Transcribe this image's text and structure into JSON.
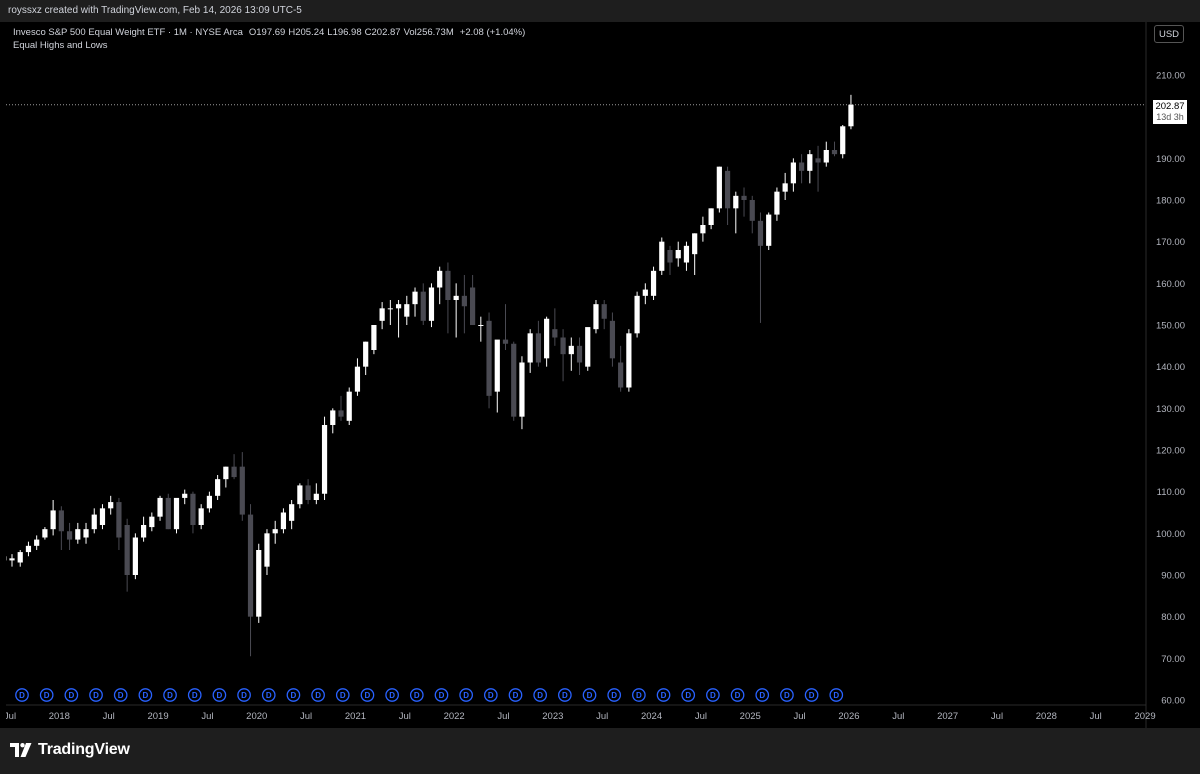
{
  "header": {
    "attribution": "royssxz created with TradingView.com, Feb 14, 2026 13:09 UTC-5"
  },
  "legend": {
    "symbol_line": "Invesco S&P 500 Equal Weight ETF · 1M · NYSE Arca",
    "open_label": "O",
    "open_value": "197.69",
    "high_label": "H",
    "high_value": "205.24",
    "low_label": "L",
    "low_value": "196.98",
    "close_label": "C",
    "close_value": "202.87",
    "volume_label": "Vol",
    "volume_value": "256.73M",
    "change": "+2.08 (+1.04%)",
    "indicator_name": "Equal Highs and Lows"
  },
  "currency_button": "USD",
  "price_tag": {
    "price": "202.87",
    "countdown": "13d 3h"
  },
  "footer": {
    "brand": "TradingView"
  },
  "colors": {
    "background": "#000000",
    "up_candle": "#ffffff",
    "down_candle": "#4a4a52",
    "axis_text": "#b2b5be",
    "dividend_marker": "#2962ff",
    "bar_background": "#1e1e1e"
  },
  "chart_data": {
    "type": "candlestick",
    "timeframe": "1M",
    "y_axis": {
      "min": 60,
      "max": 210,
      "ticks": [
        60,
        70,
        80,
        90,
        100,
        110,
        120,
        130,
        140,
        150,
        160,
        170,
        180,
        190,
        200,
        210
      ],
      "tick_labels": [
        "60.00",
        "70.00",
        "80.00",
        "90.00",
        "100.00",
        "110.00",
        "120.00",
        "130.00",
        "140.00",
        "150.00",
        "160.00",
        "170.00",
        "180.00",
        "190.00",
        "200.00",
        "210.00"
      ],
      "position": "right"
    },
    "x_axis": {
      "tick_labels": [
        "Jul",
        "2018",
        "Jul",
        "2019",
        "Jul",
        "2020",
        "Jul",
        "2021",
        "Jul",
        "2022",
        "Jul",
        "2023",
        "Jul",
        "2024",
        "Jul",
        "2025",
        "Jul",
        "2026",
        "Jul",
        "2027",
        "Jul",
        "2028",
        "Jul",
        "2029"
      ],
      "first_tick_month_index": 0,
      "months_per_tick": 6
    },
    "first_candle_month_index": -1,
    "last_price_line": 202.87,
    "candles": [
      {
        "o": 93.5,
        "h": 96,
        "l": 92,
        "c": 94.5
      },
      {
        "o": 93.5,
        "h": 95,
        "l": 92,
        "c": 94
      },
      {
        "o": 93,
        "h": 96,
        "l": 92,
        "c": 95.5
      },
      {
        "o": 95.5,
        "h": 98,
        "l": 94.5,
        "c": 97
      },
      {
        "o": 97,
        "h": 99.5,
        "l": 96,
        "c": 98.5
      },
      {
        "o": 99,
        "h": 101.5,
        "l": 98.5,
        "c": 101
      },
      {
        "o": 101,
        "h": 108,
        "l": 99.5,
        "c": 105.5
      },
      {
        "o": 105.5,
        "h": 106.5,
        "l": 96,
        "c": 100.5
      },
      {
        "o": 100.5,
        "h": 102.5,
        "l": 96,
        "c": 98.5
      },
      {
        "o": 98.5,
        "h": 102.5,
        "l": 97.5,
        "c": 101
      },
      {
        "o": 99,
        "h": 102.5,
        "l": 97.5,
        "c": 101
      },
      {
        "o": 101,
        "h": 106,
        "l": 100,
        "c": 104.5
      },
      {
        "o": 102,
        "h": 107,
        "l": 101,
        "c": 106
      },
      {
        "o": 106,
        "h": 109,
        "l": 104.5,
        "c": 107.5
      },
      {
        "o": 107.5,
        "h": 108.5,
        "l": 96,
        "c": 99
      },
      {
        "o": 102,
        "h": 103.5,
        "l": 86,
        "c": 90
      },
      {
        "o": 90,
        "h": 100,
        "l": 89,
        "c": 99
      },
      {
        "o": 99,
        "h": 104,
        "l": 98,
        "c": 102
      },
      {
        "o": 101.5,
        "h": 105,
        "l": 100.5,
        "c": 104
      },
      {
        "o": 104,
        "h": 109,
        "l": 103,
        "c": 108.5
      },
      {
        "o": 108.5,
        "h": 109.5,
        "l": 101,
        "c": 101
      },
      {
        "o": 101,
        "h": 108,
        "l": 100,
        "c": 108.5
      },
      {
        "o": 108.5,
        "h": 110.5,
        "l": 107,
        "c": 109.5
      },
      {
        "o": 109.5,
        "h": 110,
        "l": 100,
        "c": 102
      },
      {
        "o": 102,
        "h": 107,
        "l": 101,
        "c": 106
      },
      {
        "o": 106,
        "h": 110,
        "l": 105,
        "c": 109
      },
      {
        "o": 109,
        "h": 114,
        "l": 108,
        "c": 113
      },
      {
        "o": 113,
        "h": 116,
        "l": 111,
        "c": 116
      },
      {
        "o": 116,
        "h": 119,
        "l": 113,
        "c": 113.5
      },
      {
        "o": 116,
        "h": 119.5,
        "l": 103,
        "c": 104.5
      },
      {
        "o": 104.5,
        "h": 107,
        "l": 70.5,
        "c": 80
      },
      {
        "o": 80,
        "h": 97.5,
        "l": 78.5,
        "c": 96
      },
      {
        "o": 92,
        "h": 101,
        "l": 90,
        "c": 100
      },
      {
        "o": 100,
        "h": 103,
        "l": 97.5,
        "c": 101
      },
      {
        "o": 101,
        "h": 106,
        "l": 100,
        "c": 105
      },
      {
        "o": 103,
        "h": 108,
        "l": 101,
        "c": 107
      },
      {
        "o": 107,
        "h": 112,
        "l": 106,
        "c": 111.5
      },
      {
        "o": 111.5,
        "h": 113,
        "l": 107,
        "c": 108
      },
      {
        "o": 108,
        "h": 112,
        "l": 107,
        "c": 109.5
      },
      {
        "o": 109.5,
        "h": 128,
        "l": 108,
        "c": 126
      },
      {
        "o": 126,
        "h": 130,
        "l": 124,
        "c": 129.5
      },
      {
        "o": 129.5,
        "h": 133,
        "l": 127,
        "c": 128
      },
      {
        "o": 127,
        "h": 135,
        "l": 126,
        "c": 134
      },
      {
        "o": 134,
        "h": 142,
        "l": 133,
        "c": 140
      },
      {
        "o": 140,
        "h": 146,
        "l": 138,
        "c": 146
      },
      {
        "o": 144,
        "h": 150,
        "l": 143,
        "c": 150
      },
      {
        "o": 151,
        "h": 155.5,
        "l": 149,
        "c": 154
      },
      {
        "o": 154,
        "h": 156,
        "l": 150,
        "c": 154
      },
      {
        "o": 154,
        "h": 156,
        "l": 147,
        "c": 155
      },
      {
        "o": 152,
        "h": 157,
        "l": 150,
        "c": 155
      },
      {
        "o": 155,
        "h": 159,
        "l": 152,
        "c": 158
      },
      {
        "o": 158,
        "h": 160,
        "l": 150,
        "c": 151
      },
      {
        "o": 151,
        "h": 160,
        "l": 149.5,
        "c": 159
      },
      {
        "o": 159,
        "h": 164,
        "l": 155,
        "c": 163
      },
      {
        "o": 163,
        "h": 165,
        "l": 148,
        "c": 156
      },
      {
        "o": 156,
        "h": 160,
        "l": 147,
        "c": 157
      },
      {
        "o": 157,
        "h": 162,
        "l": 148,
        "c": 154.5
      },
      {
        "o": 159,
        "h": 162,
        "l": 150,
        "c": 150
      },
      {
        "o": 150,
        "h": 152,
        "l": 146,
        "c": 150
      },
      {
        "o": 151,
        "h": 153,
        "l": 130,
        "c": 133
      },
      {
        "o": 134,
        "h": 140,
        "l": 129,
        "c": 146.5
      },
      {
        "o": 146.5,
        "h": 155,
        "l": 144,
        "c": 145.5
      },
      {
        "o": 145.5,
        "h": 146,
        "l": 127,
        "c": 128
      },
      {
        "o": 128,
        "h": 142.5,
        "l": 125,
        "c": 141
      },
      {
        "o": 141,
        "h": 149,
        "l": 138.5,
        "c": 148
      },
      {
        "o": 148,
        "h": 151,
        "l": 140,
        "c": 141
      },
      {
        "o": 142,
        "h": 152,
        "l": 140,
        "c": 151.5
      },
      {
        "o": 149,
        "h": 154,
        "l": 145,
        "c": 147
      },
      {
        "o": 147,
        "h": 149,
        "l": 136.5,
        "c": 143
      },
      {
        "o": 143,
        "h": 147,
        "l": 139,
        "c": 145
      },
      {
        "o": 145,
        "h": 147,
        "l": 138,
        "c": 141
      },
      {
        "o": 140,
        "h": 148,
        "l": 139,
        "c": 149.5
      },
      {
        "o": 149,
        "h": 156,
        "l": 148,
        "c": 155
      },
      {
        "o": 155,
        "h": 156,
        "l": 149,
        "c": 151.5
      },
      {
        "o": 151,
        "h": 153,
        "l": 140,
        "c": 142
      },
      {
        "o": 141,
        "h": 145,
        "l": 134,
        "c": 135
      },
      {
        "o": 135,
        "h": 149,
        "l": 134,
        "c": 148
      },
      {
        "o": 148,
        "h": 158,
        "l": 147,
        "c": 157
      },
      {
        "o": 157,
        "h": 160,
        "l": 155,
        "c": 158.5
      },
      {
        "o": 157,
        "h": 164,
        "l": 156,
        "c": 163
      },
      {
        "o": 163,
        "h": 171,
        "l": 162,
        "c": 170
      },
      {
        "o": 168,
        "h": 169,
        "l": 162,
        "c": 165
      },
      {
        "o": 166,
        "h": 170,
        "l": 164,
        "c": 168
      },
      {
        "o": 165,
        "h": 170,
        "l": 163,
        "c": 169
      },
      {
        "o": 167,
        "h": 172,
        "l": 162,
        "c": 172
      },
      {
        "o": 172,
        "h": 176,
        "l": 170,
        "c": 174
      },
      {
        "o": 174,
        "h": 178,
        "l": 173,
        "c": 178
      },
      {
        "o": 178,
        "h": 188,
        "l": 177,
        "c": 188
      },
      {
        "o": 187,
        "h": 188,
        "l": 174,
        "c": 178
      },
      {
        "o": 178,
        "h": 182,
        "l": 172,
        "c": 181
      },
      {
        "o": 181,
        "h": 183,
        "l": 176,
        "c": 180
      },
      {
        "o": 180,
        "h": 181,
        "l": 172,
        "c": 175
      },
      {
        "o": 175,
        "h": 177,
        "l": 150.5,
        "c": 169
      },
      {
        "o": 169,
        "h": 177,
        "l": 168,
        "c": 176.5
      },
      {
        "o": 176.5,
        "h": 183,
        "l": 175,
        "c": 182
      },
      {
        "o": 182,
        "h": 186.5,
        "l": 180,
        "c": 184
      },
      {
        "o": 184,
        "h": 190,
        "l": 182,
        "c": 189
      },
      {
        "o": 189,
        "h": 191,
        "l": 184,
        "c": 187
      },
      {
        "o": 187,
        "h": 192,
        "l": 184,
        "c": 191
      },
      {
        "o": 190,
        "h": 193,
        "l": 182,
        "c": 189
      },
      {
        "o": 189,
        "h": 194,
        "l": 188,
        "c": 192
      },
      {
        "o": 192,
        "h": 194,
        "l": 190.5,
        "c": 191
      },
      {
        "o": 191,
        "h": 198,
        "l": 190,
        "c": 197.69
      },
      {
        "o": 197.69,
        "h": 205.24,
        "l": 196.98,
        "c": 202.87
      }
    ],
    "dividend_markers": {
      "label": "D",
      "first_month_index": 0,
      "every_n_months": 3,
      "count": 34
    }
  }
}
